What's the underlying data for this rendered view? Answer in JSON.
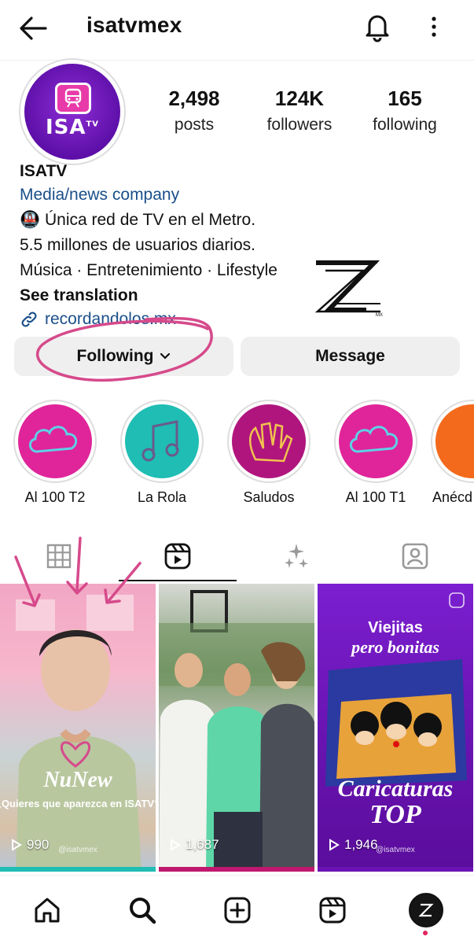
{
  "header": {
    "username": "isatvmex"
  },
  "profile": {
    "avatar_text": "ISA",
    "avatar_sup": "TV",
    "stats": [
      {
        "value": "2,498",
        "label": "posts"
      },
      {
        "value": "124K",
        "label": "followers"
      },
      {
        "value": "165",
        "label": "following"
      }
    ],
    "name": "ISATV",
    "category": "Media/news company",
    "bio_lines": [
      "🚇 Única red de TV en el Metro.",
      "5.5 millones de usuarios diarios.",
      "Música · Entretenimiento · Lifestyle"
    ],
    "see_translation": "See translation",
    "link": "recordandolos.mx",
    "watermark_sub": "MX"
  },
  "actions": {
    "following": "Following",
    "message": "Message"
  },
  "highlights": [
    {
      "label": "Al 100 T2",
      "color": "#e0249a"
    },
    {
      "label": "La Rola",
      "color": "#1fbdb4"
    },
    {
      "label": "Saludos",
      "color": "#b0157e"
    },
    {
      "label": "Al 100 T1",
      "color": "#e0249a"
    },
    {
      "label": "Anécd",
      "color": "#f36a1c"
    }
  ],
  "tabs": [
    {
      "name": "tab-grid",
      "icon": "grid-icon"
    },
    {
      "name": "tab-reels",
      "icon": "reels-icon",
      "active": true
    },
    {
      "name": "tab-sparkles",
      "icon": "sparkles-icon"
    },
    {
      "name": "tab-tagged",
      "icon": "tagged-user-icon"
    }
  ],
  "posts": [
    {
      "views": "990",
      "handle": "@isatvmex",
      "overlay_title": "NuNew",
      "overlay_sub": "¿Quieres que aparezca en ISATV?"
    },
    {
      "views": "1,687"
    },
    {
      "views": "1,946",
      "handle": "@isatvmex",
      "overlay_top1": "Viejitas",
      "overlay_top2": "pero bonitas",
      "overlay_bottom1": "Caricaturas",
      "overlay_bottom2": "TOP"
    }
  ],
  "colors": {
    "brand_purple": "#6a14b3",
    "accent_pink": "#d64a8b",
    "link_blue": "#1a4f8a"
  }
}
